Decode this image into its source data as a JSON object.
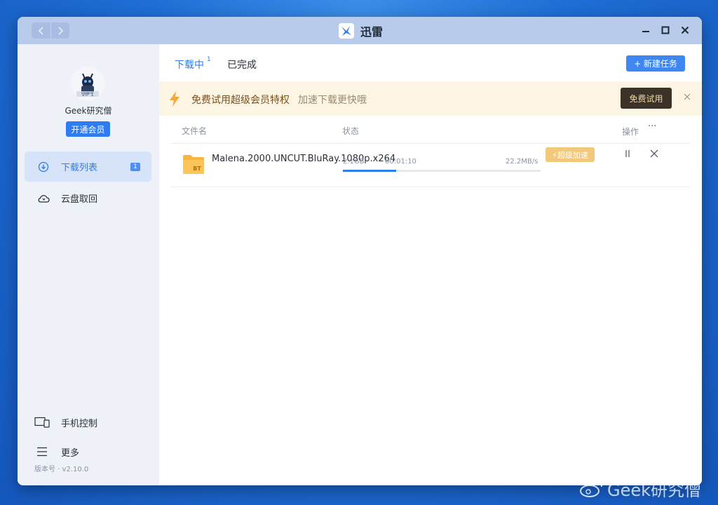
{
  "window": {
    "title": "迅雷",
    "nav": {
      "back_icon": "chevron-left-icon",
      "forward_icon": "chevron-right-icon"
    },
    "controls": {
      "minimize_icon": "minimize-icon",
      "maximize_icon": "maximize-icon",
      "close_icon": "close-icon"
    }
  },
  "sidebar": {
    "avatar_badge": "VIP 1",
    "username": "Geek研究僧",
    "vip_button": "开通会员",
    "items": [
      {
        "label": "下载列表",
        "icon": "download-icon",
        "badge": "1",
        "active": true
      },
      {
        "label": "云盘取回",
        "icon": "cloud-icon",
        "active": false
      }
    ],
    "bottom": [
      {
        "label": "手机控制",
        "icon": "devices-icon"
      },
      {
        "label": "更多",
        "icon": "menu-icon"
      }
    ],
    "version": "版本号 · v2.10.0"
  },
  "main": {
    "tabs": [
      {
        "label": "下载中",
        "count": "1",
        "active": true
      },
      {
        "label": "已完成",
        "active": false
      }
    ],
    "new_task_label": "+ 新建任务",
    "promo": {
      "title": "免费试用超级会员特权",
      "subtitle": "加速下载更快哦",
      "button": "免费试用",
      "close_icon": "close-icon"
    },
    "columns": {
      "name": "文件名",
      "status": "状态",
      "actions": "操作",
      "more": "···"
    },
    "downloads": [
      {
        "type": "BT",
        "name": "Malena.2000.UNCUT.BluRay.1080p.x264",
        "size": "2.1GB",
        "time": "00:01:10",
        "speed": "22.2MB/s",
        "progress": 0.27,
        "boost_label": "⚡超级加速",
        "pause_icon": "pause-icon",
        "delete_icon": "close-icon"
      }
    ]
  },
  "watermark": {
    "text": "Geek研究僧",
    "icon": "weibo-icon"
  },
  "colors": {
    "accent": "#2f7bf0",
    "sidebar_bg": "#eef2f8",
    "titlebar_bg": "#b9cbea",
    "promo_bg": "#fdf5e4",
    "boost": "#f2c87a"
  }
}
